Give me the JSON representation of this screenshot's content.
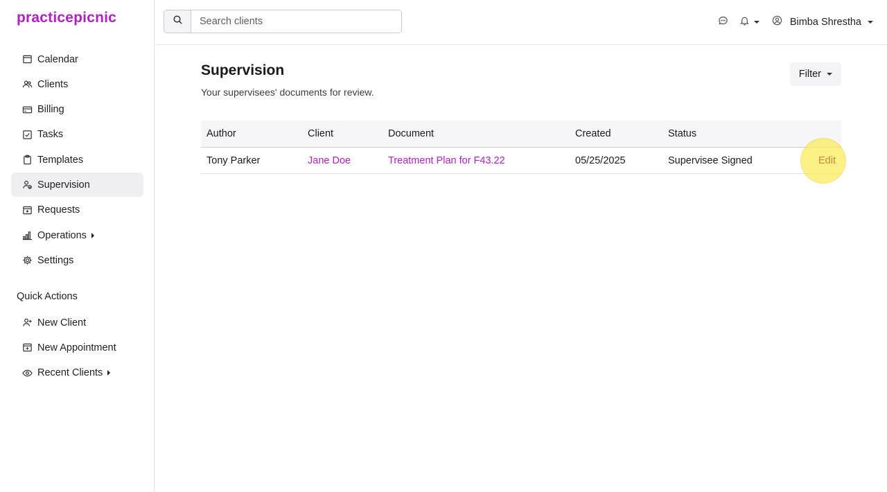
{
  "app": {
    "brand": "practicepicnic"
  },
  "sidebar": {
    "items": [
      {
        "label": "Calendar",
        "icon": "calendar-icon"
      },
      {
        "label": "Clients",
        "icon": "users-icon"
      },
      {
        "label": "Billing",
        "icon": "credit-card-icon"
      },
      {
        "label": "Tasks",
        "icon": "checkbox-icon"
      },
      {
        "label": "Templates",
        "icon": "clipboard-icon"
      },
      {
        "label": "Supervision",
        "icon": "user-check-icon",
        "active": true
      },
      {
        "label": "Requests",
        "icon": "calendar-plus-icon"
      },
      {
        "label": "Operations",
        "icon": "bar-chart-icon",
        "submenu": true
      },
      {
        "label": "Settings",
        "icon": "gear-icon"
      }
    ],
    "quick_actions_title": "Quick Actions",
    "quick_actions": [
      {
        "label": "New Client",
        "icon": "user-plus-icon"
      },
      {
        "label": "New Appointment",
        "icon": "calendar-plus-icon"
      },
      {
        "label": "Recent Clients",
        "icon": "eye-icon",
        "submenu": true
      }
    ]
  },
  "topbar": {
    "search": {
      "placeholder": "Search clients",
      "value": ""
    },
    "user_name": "Bimba Shrestha"
  },
  "main": {
    "title": "Supervision",
    "subtitle": "Your supervisees' documents for review.",
    "filter_label": "Filter",
    "table": {
      "headers": [
        "Author",
        "Client",
        "Document",
        "Created",
        "Status",
        ""
      ],
      "rows": [
        {
          "author": "Tony Parker",
          "client": "Jane Doe",
          "document": "Treatment Plan for F43.22",
          "created": "05/25/2025",
          "status": "Supervisee Signed",
          "action": "Edit"
        }
      ]
    }
  },
  "colors": {
    "brand": "#b31fc4",
    "active_nav_bg": "#efeff1",
    "highlight": "#f5e04a"
  }
}
